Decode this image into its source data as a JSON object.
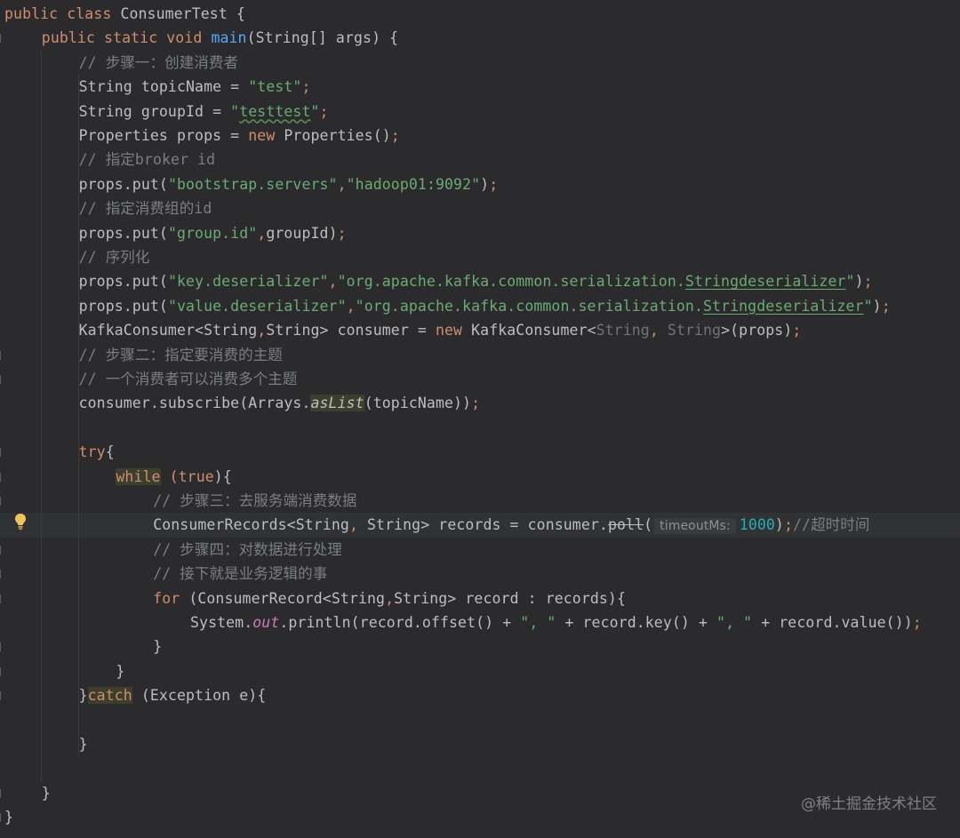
{
  "editor": {
    "language": "java",
    "lines": [
      {
        "indent": 0,
        "tokens": [
          [
            "kw",
            "public class "
          ],
          [
            "",
            "ConsumerTest {"
          ]
        ]
      },
      {
        "indent": 1,
        "tokens": [
          [
            "kw",
            "public static void "
          ],
          [
            "fn",
            "main"
          ],
          [
            "",
            "(String[] args) {"
          ]
        ]
      },
      {
        "indent": 2,
        "tokens": [
          [
            "cm",
            "// 步骤一：创建消费者"
          ]
        ]
      },
      {
        "indent": 2,
        "tokens": [
          [
            "",
            "String topicName = "
          ],
          [
            "str",
            "\"test\""
          ],
          [
            "kw",
            ";"
          ]
        ]
      },
      {
        "indent": 2,
        "tokens": [
          [
            "",
            "String groupId = "
          ],
          [
            "str",
            "\""
          ],
          [
            "str typo",
            "testtest"
          ],
          [
            "str",
            "\""
          ],
          [
            "kw",
            ";"
          ]
        ]
      },
      {
        "indent": 2,
        "tokens": [
          [
            "",
            "Properties props = "
          ],
          [
            "kw",
            "new "
          ],
          [
            "",
            "Properties()"
          ],
          [
            "kw",
            ";"
          ]
        ]
      },
      {
        "indent": 2,
        "tokens": [
          [
            "cm",
            "// 指定broker id"
          ]
        ]
      },
      {
        "indent": 2,
        "tokens": [
          [
            "",
            "props.put("
          ],
          [
            "str",
            "\"bootstrap.servers\""
          ],
          [
            "kw",
            ","
          ],
          [
            "str",
            "\"hadoop01:9092\""
          ],
          [
            "",
            ")"
          ],
          [
            "kw",
            ";"
          ]
        ]
      },
      {
        "indent": 2,
        "tokens": [
          [
            "cm",
            "// 指定消费组的id"
          ]
        ]
      },
      {
        "indent": 2,
        "tokens": [
          [
            "",
            "props.put("
          ],
          [
            "str",
            "\"group.id\""
          ],
          [
            "kw",
            ","
          ],
          [
            "",
            "groupId)"
          ],
          [
            "kw",
            ";"
          ]
        ]
      },
      {
        "indent": 2,
        "tokens": [
          [
            "cm",
            "// 序列化"
          ]
        ]
      },
      {
        "indent": 2,
        "tokens": [
          [
            "",
            "props.put("
          ],
          [
            "str",
            "\"key.deserializer\""
          ],
          [
            "kw",
            ","
          ],
          [
            "str",
            "\"org.apache.kafka.common.serialization."
          ],
          [
            "str under",
            "Stringdeserializer"
          ],
          [
            "str",
            "\""
          ],
          [
            "",
            ")"
          ],
          [
            "kw",
            ";"
          ]
        ]
      },
      {
        "indent": 2,
        "tokens": [
          [
            "",
            "props.put("
          ],
          [
            "str",
            "\"value.deserializer\""
          ],
          [
            "kw",
            ","
          ],
          [
            "str",
            "\"org.apache.kafka.common.serialization."
          ],
          [
            "str under",
            "Stringdeserializer"
          ],
          [
            "str",
            "\""
          ],
          [
            "",
            ")"
          ],
          [
            "kw",
            ";"
          ]
        ]
      },
      {
        "indent": 2,
        "tokens": [
          [
            "",
            "KafkaConsumer<String"
          ],
          [
            "kw",
            ","
          ],
          [
            "",
            "String> consumer = "
          ],
          [
            "kw",
            "new "
          ],
          [
            "",
            "KafkaConsumer<"
          ],
          [
            "gray",
            "String"
          ],
          [
            "kw",
            ", "
          ],
          [
            "gray",
            "String"
          ],
          [
            "",
            ">(props)"
          ],
          [
            "kw",
            ";"
          ]
        ]
      },
      {
        "indent": 2,
        "tokens": [
          [
            "cm",
            "// 步骤二：指定要消费的主题"
          ]
        ]
      },
      {
        "indent": 2,
        "tokens": [
          [
            "cm",
            "// 一个消费者可以消费多个主题"
          ]
        ]
      },
      {
        "indent": 2,
        "tokens": [
          [
            "",
            "consumer.subscribe(Arrays."
          ],
          [
            "stat hl",
            "asList"
          ],
          [
            "",
            "(topicName))"
          ],
          [
            "kw",
            ";"
          ]
        ]
      },
      {
        "indent": 0,
        "tokens": []
      },
      {
        "indent": 2,
        "tokens": [
          [
            "kw",
            "try"
          ],
          [
            "",
            "{"
          ]
        ]
      },
      {
        "indent": 3,
        "tokens": [
          [
            "kw hl",
            "while"
          ],
          [
            "",
            ""
          ],
          [
            "kw",
            " (true"
          ],
          [
            "",
            "){"
          ]
        ]
      },
      {
        "indent": 4,
        "tokens": [
          [
            "cm",
            "// 步骤三：去服务端消费数据"
          ]
        ]
      },
      {
        "indent": 4,
        "current": true,
        "tokens": [
          [
            "",
            "ConsumerRecords<String"
          ],
          [
            "kw",
            ", "
          ],
          [
            "",
            "String> records = consumer."
          ],
          [
            "strike",
            "poll"
          ],
          [
            "",
            "("
          ],
          [
            "hint",
            "timeoutMs:"
          ],
          [
            "num",
            "1000"
          ],
          [
            "",
            ")"
          ],
          [
            "kw",
            ";"
          ],
          [
            "cm",
            "//超时时间"
          ]
        ]
      },
      {
        "indent": 4,
        "tokens": [
          [
            "cm",
            "// 步骤四：对数据进行处理"
          ]
        ]
      },
      {
        "indent": 4,
        "tokens": [
          [
            "cm",
            "// 接下就是业务逻辑的事"
          ]
        ]
      },
      {
        "indent": 4,
        "tokens": [
          [
            "kw",
            "for "
          ],
          [
            "",
            "(ConsumerRecord<String"
          ],
          [
            "kw",
            ","
          ],
          [
            "",
            "String> record : records){"
          ]
        ]
      },
      {
        "indent": 5,
        "tokens": [
          [
            "",
            "System."
          ],
          [
            "field",
            "out"
          ],
          [
            "",
            ".println(record.offset() + "
          ],
          [
            "str",
            "\", \""
          ],
          [
            "",
            " + record.key() + "
          ],
          [
            "str",
            "\", \""
          ],
          [
            "",
            " + record.value())"
          ],
          [
            "kw",
            ";"
          ]
        ]
      },
      {
        "indent": 4,
        "tokens": [
          [
            "",
            "}"
          ]
        ]
      },
      {
        "indent": 3,
        "tokens": [
          [
            "",
            "}"
          ]
        ]
      },
      {
        "indent": 2,
        "tokens": [
          [
            "",
            "}"
          ],
          [
            "kw hl",
            "catch"
          ],
          [
            "",
            " (Exception e){"
          ]
        ]
      },
      {
        "indent": 0,
        "tokens": []
      },
      {
        "indent": 2,
        "tokens": [
          [
            "",
            "}"
          ]
        ]
      },
      {
        "indent": 0,
        "tokens": []
      },
      {
        "indent": 1,
        "tokens": [
          [
            "",
            "}"
          ]
        ]
      },
      {
        "indent": 0,
        "tokens": [
          [
            "",
            "}"
          ]
        ]
      }
    ]
  },
  "gutter": {
    "current_line_icon": "lightbulb-icon"
  },
  "watermark": {
    "text": "@稀土掘金技术社区"
  },
  "colors": {
    "background": "#2b2b2d",
    "keyword": "#cf8e6d",
    "method": "#56a8f5",
    "string": "#6aab73",
    "comment": "#7a7e85",
    "number": "#2aacb8",
    "field": "#c77dbb",
    "text": "#bcbec4",
    "bulb": "#f2c55c"
  }
}
